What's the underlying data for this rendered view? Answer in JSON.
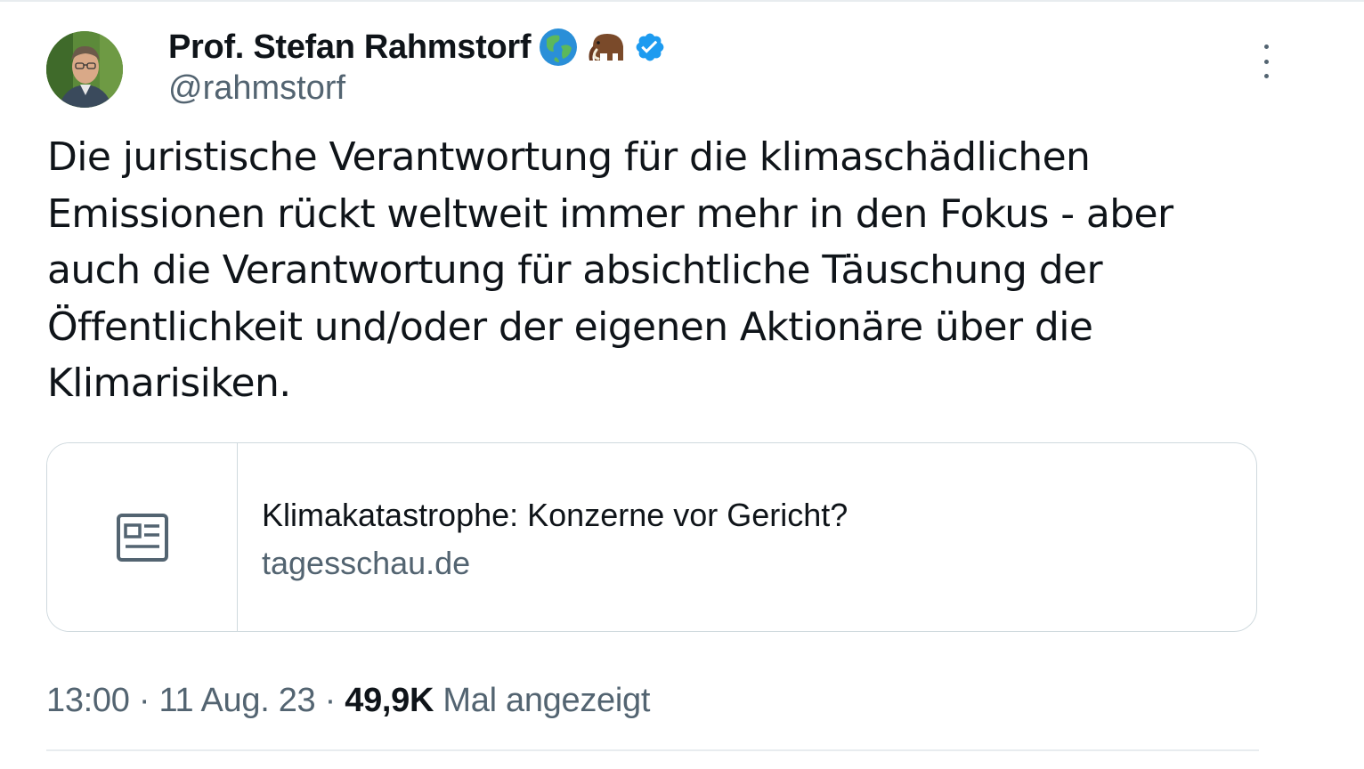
{
  "author": {
    "display_name": "Prof. Stefan Rahmstorf",
    "handle": "@rahmstorf",
    "name_emojis": [
      "globe-icon",
      "mammoth-icon"
    ],
    "verified": true
  },
  "tweet": {
    "text_lines": [
      "Die juristische Verantwortung für die klimaschädlichen",
      "Emissionen rückt weltweit immer mehr in den Fokus - aber",
      "auch die Verantwortung für absichtliche Täuschung der",
      "Öffentlichkeit und/oder der eigenen Aktionäre über die",
      "Klimarisiken."
    ]
  },
  "link_card": {
    "icon": "news-article-icon",
    "title": "Klimakatastrophe: Konzerne vor Gericht?",
    "domain": "tagesschau.de"
  },
  "meta": {
    "time": "13:00",
    "separator": " · ",
    "date": "11 Aug. 23",
    "views_count": "49,9K",
    "views_label": " Mal angezeigt"
  },
  "colors": {
    "text_primary": "#0f1419",
    "text_secondary": "#536471",
    "verified_blue": "#1d9bf0",
    "border": "#cfd9de"
  }
}
